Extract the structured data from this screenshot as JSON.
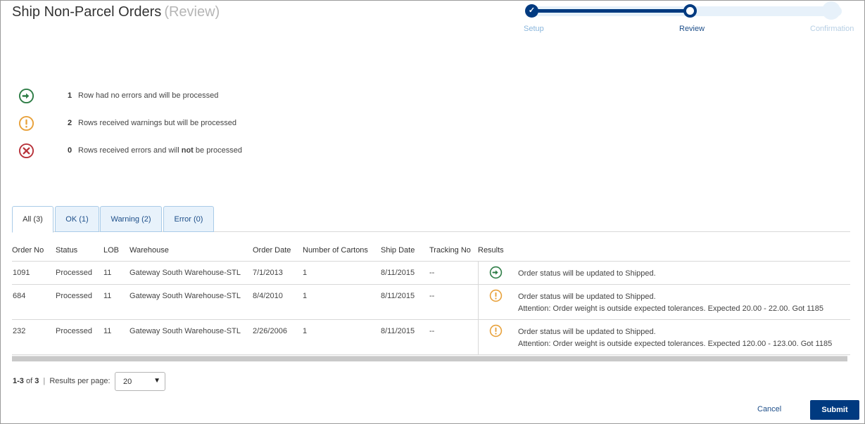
{
  "header": {
    "title": "Ship Non-Parcel Orders",
    "subtitle": "(Review)"
  },
  "stepper": {
    "steps": [
      {
        "label": "Setup",
        "state": "done"
      },
      {
        "label": "Review",
        "state": "current"
      },
      {
        "label": "Confirmation",
        "state": "future"
      }
    ]
  },
  "summary": [
    {
      "icon": "arrow-right-circle-icon",
      "count": "1",
      "text": "Row had no errors and will be processed"
    },
    {
      "icon": "exclamation-circle-icon",
      "count": "2",
      "text": "Rows received warnings but will be processed"
    },
    {
      "icon": "x-circle-icon",
      "count": "0",
      "text_before": "Rows received errors and will",
      "text_bold": "not",
      "text_after": "be processed"
    }
  ],
  "tabs": [
    {
      "label": "All (3)",
      "active": true
    },
    {
      "label": "OK (1)",
      "active": false
    },
    {
      "label": "Warning (2)",
      "active": false
    },
    {
      "label": "Error (0)",
      "active": false
    }
  ],
  "table": {
    "columns": [
      "Order No",
      "Status",
      "LOB",
      "Warehouse",
      "Order Date",
      "Number of Cartons",
      "Ship Date",
      "Tracking No",
      "Results"
    ],
    "rows": [
      {
        "order_no": "1091",
        "status": "Processed",
        "lob": "11",
        "warehouse": "Gateway South Warehouse-STL",
        "order_date": "7/1/2013",
        "cartons": "1",
        "ship_date": "8/11/2015",
        "tracking": "--",
        "result_icon": "arrow-right-circle-icon",
        "result_lines": [
          "Order status will be updated to Shipped."
        ]
      },
      {
        "order_no": "684",
        "status": "Processed",
        "lob": "11",
        "warehouse": "Gateway South Warehouse-STL",
        "order_date": "8/4/2010",
        "cartons": "1",
        "ship_date": "8/11/2015",
        "tracking": "--",
        "result_icon": "exclamation-circle-icon",
        "result_lines": [
          "Order status will be updated to Shipped.",
          "Attention: Order weight is outside expected tolerances. Expected 20.00 - 22.00. Got 1185"
        ]
      },
      {
        "order_no": "232",
        "status": "Processed",
        "lob": "11",
        "warehouse": "Gateway South Warehouse-STL",
        "order_date": "2/26/2006",
        "cartons": "1",
        "ship_date": "8/11/2015",
        "tracking": "--",
        "result_icon": "exclamation-circle-icon",
        "result_lines": [
          "Order status will be updated to Shipped.",
          "Attention: Order weight is outside expected tolerances. Expected 120.00 - 123.00. Got 1185"
        ]
      }
    ]
  },
  "pagination": {
    "range": "1-3",
    "of_label": "of",
    "total": "3",
    "per_page_label": "Results per page:",
    "per_page_value": "20"
  },
  "actions": {
    "cancel_label": "Cancel",
    "submit_label": "Submit"
  },
  "colors": {
    "ok": "#2e7d46",
    "warning": "#e8a13a",
    "error": "#b8333b",
    "primary": "#003a80"
  }
}
